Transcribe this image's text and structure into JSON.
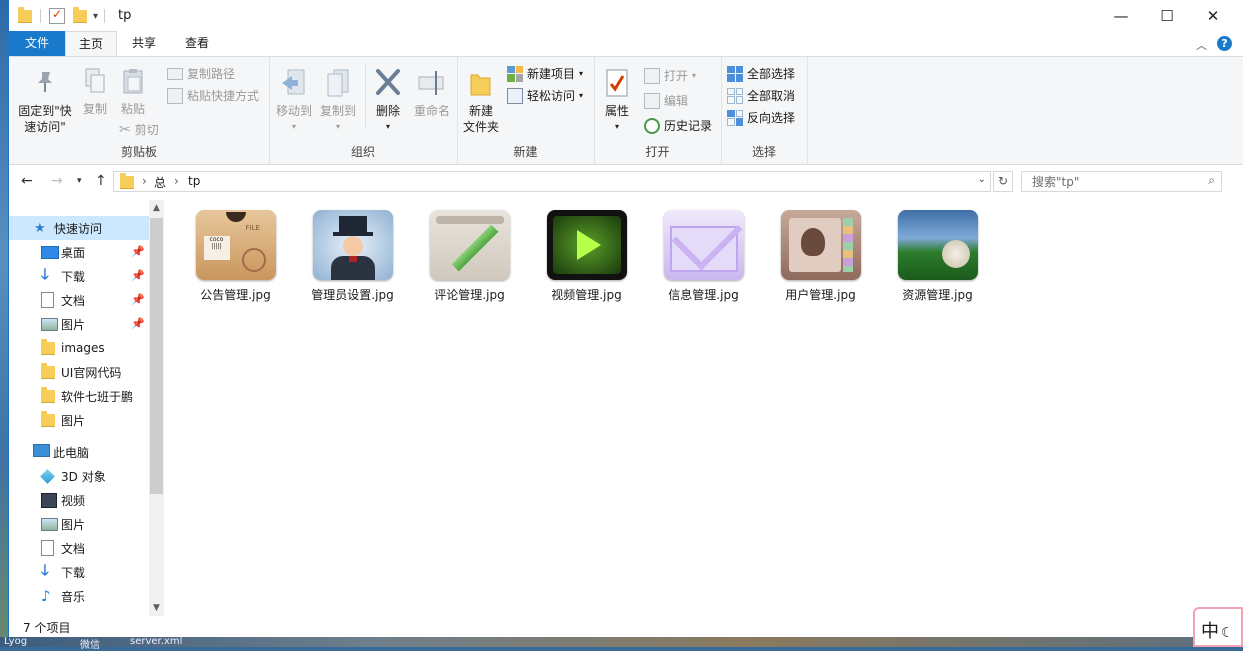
{
  "window": {
    "title": "tp",
    "controls": {
      "minimize": "—",
      "maximize": "☐",
      "close": "✕"
    }
  },
  "tabs": {
    "file": "文件",
    "home": "主页",
    "share": "共享",
    "view": "查看"
  },
  "ribbon": {
    "clipboard": {
      "label": "剪贴板",
      "pin": "固定到\"快\n速访问\"",
      "copy": "复制",
      "paste": "粘贴",
      "copy_path": "复制路径",
      "paste_shortcut": "粘贴快捷方式",
      "cut": "剪切"
    },
    "organize": {
      "label": "组织",
      "move_to": "移动到",
      "copy_to": "复制到",
      "delete": "删除",
      "rename": "重命名"
    },
    "new": {
      "label": "新建",
      "new_folder": "新建\n文件夹",
      "new_item": "新建项目",
      "easy_access": "轻松访问"
    },
    "open": {
      "label": "打开",
      "properties": "属性",
      "open": "打开",
      "edit": "编辑",
      "history": "历史记录"
    },
    "select": {
      "label": "选择",
      "select_all": "全部选择",
      "select_none": "全部取消",
      "invert": "反向选择"
    }
  },
  "address": {
    "path": [
      "总",
      "tp"
    ],
    "search_placeholder": "搜索\"tp\""
  },
  "nav": {
    "quick_access": "快速访问",
    "quick_items": [
      {
        "label": "桌面",
        "icon": "desktop-icon",
        "pinned": true
      },
      {
        "label": "下载",
        "icon": "download-icon",
        "pinned": true
      },
      {
        "label": "文档",
        "icon": "document-icon",
        "pinned": true
      },
      {
        "label": "图片",
        "icon": "picture-icon",
        "pinned": true
      },
      {
        "label": "images",
        "icon": "folder-icon",
        "pinned": false
      },
      {
        "label": "UI官网代码",
        "icon": "folder-icon",
        "pinned": false
      },
      {
        "label": "软件七班于鹏",
        "icon": "folder-icon",
        "pinned": false
      },
      {
        "label": "图片",
        "icon": "folder-icon",
        "pinned": false
      }
    ],
    "this_pc": "此电脑",
    "pc_items": [
      {
        "label": "3D 对象",
        "icon": "3d-objects-icon"
      },
      {
        "label": "视频",
        "icon": "video-icon"
      },
      {
        "label": "图片",
        "icon": "picture-icon"
      },
      {
        "label": "文档",
        "icon": "document-icon"
      },
      {
        "label": "下载",
        "icon": "download-icon"
      },
      {
        "label": "音乐",
        "icon": "music-icon"
      }
    ]
  },
  "files": [
    {
      "name": "公告管理.jpg",
      "thumb": "parcel"
    },
    {
      "name": "管理员设置.jpg",
      "thumb": "tophat"
    },
    {
      "name": "评论管理.jpg",
      "thumb": "pencil"
    },
    {
      "name": "视频管理.jpg",
      "thumb": "play"
    },
    {
      "name": "信息管理.jpg",
      "thumb": "mail"
    },
    {
      "name": "用户管理.jpg",
      "thumb": "contact"
    },
    {
      "name": "资源管理.jpg",
      "thumb": "stadium"
    }
  ],
  "status": {
    "count": "7 个项目"
  },
  "ime": {
    "label": "中"
  },
  "desktop": {
    "taskbar_bits": [
      "Lyog",
      "微信",
      "server.xml"
    ]
  },
  "colors": {
    "accent": "#1979ca",
    "selection": "#cce8ff",
    "folder": "#f5cd58"
  }
}
